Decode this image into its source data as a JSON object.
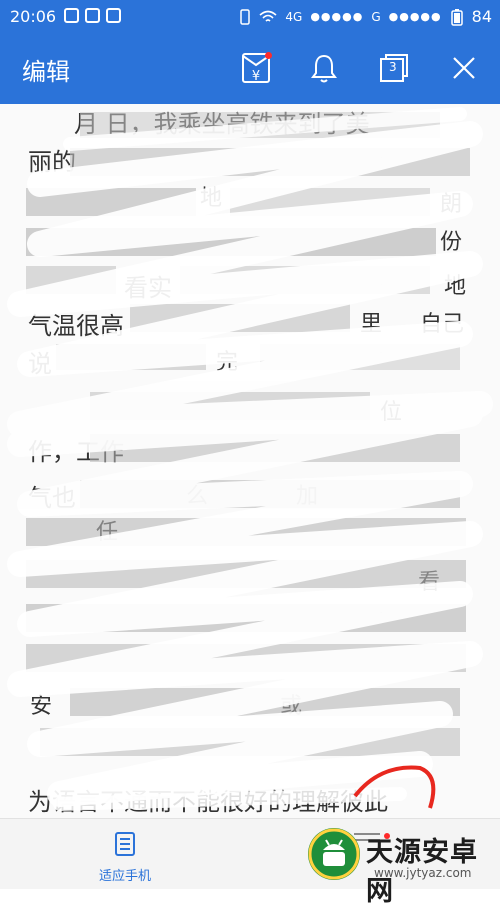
{
  "status": {
    "time": "20:06",
    "network_4g": "4G",
    "network_g": "G",
    "battery": "84"
  },
  "appbar": {
    "title": "编辑",
    "tab_count": "3"
  },
  "document": {
    "lines": [
      "月 日，我乘坐高铁来到了美",
      "丽的",
      "",
      "",
      "看实",
      "气温很高",
      "说",
      "",
      "作，工作",
      "气也",
      "",
      "",
      "",
      "",
      "",
      "",
      "为语言不通而不能很好的理解彼此"
    ],
    "fragments": [
      "地",
      "朗",
      "份",
      "地",
      "自己",
      "完",
      "位",
      "里",
      "么",
      "加",
      "任",
      "安",
      "看",
      "或"
    ]
  },
  "bottombar": {
    "fit_label": "适应手机"
  },
  "watermark": {
    "site": "天源安卓网",
    "url": "www.jytyaz.com"
  },
  "colors": {
    "primary": "#2b73d9",
    "red_dot": "#ff2b2b",
    "scribble": "#ffffff",
    "circle": "#e8281f"
  }
}
